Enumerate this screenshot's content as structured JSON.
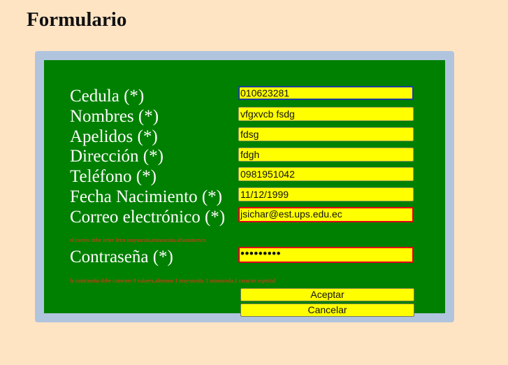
{
  "page": {
    "title": "Formulario"
  },
  "form": {
    "fields": [
      {
        "label": "Cedula (*)",
        "value": "010623281"
      },
      {
        "label": "Nombres (*)",
        "value": "vfgxvcb fsdg"
      },
      {
        "label": "Apelidos (*)",
        "value": "fdsg"
      },
      {
        "label": "Dirección (*)",
        "value": "fdgh"
      },
      {
        "label": "Teléfono (*)",
        "value": "0981951042"
      },
      {
        "label": "Fecha Nacimiento (*)",
        "value": "11/12/1999"
      },
      {
        "label": "Correo electrónico (*)",
        "value": "jsichar@est.ups.edu.ec"
      },
      {
        "label": "Contraseña (*)",
        "value": "•••••••••"
      }
    ],
    "email_error": "el correo debe tener letra mayuscula,minuscula,alfanumerico",
    "password_error": "la contraseña debe contener 8 valores,almenos 1 mayuscula, 1 minuscula,1 caracter especial",
    "submit_label": "Aceptar",
    "cancel_label": "Cancelar"
  },
  "colors": {
    "background": "#ffe4c4",
    "frame": "#b0c4de",
    "panel": "#008000",
    "input": "#ffff00",
    "error_text": "#ff2a1a"
  }
}
